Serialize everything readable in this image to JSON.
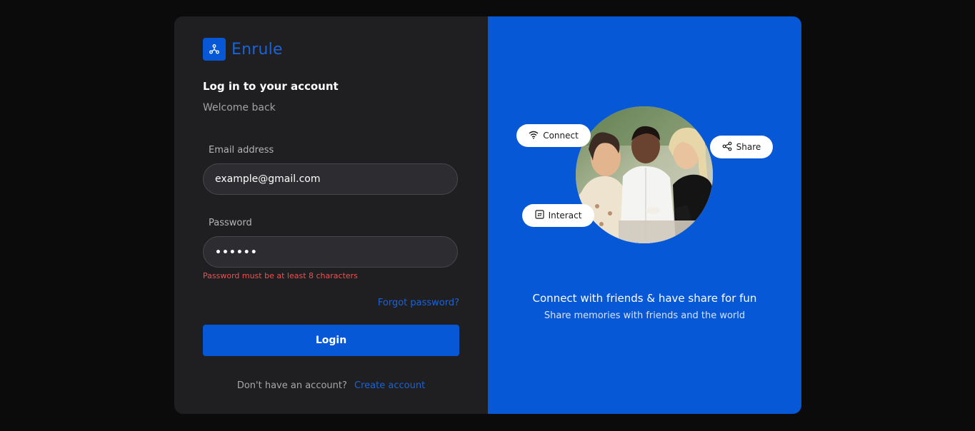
{
  "brand": {
    "name": "Enrule",
    "logo_icon": "network-nodes-icon"
  },
  "login": {
    "title": "Log in to your account",
    "subtitle": "Welcome back",
    "email_label": "Email address",
    "email_value": "example@gmail.com",
    "password_label": "Password",
    "password_value": "••••••",
    "password_error": "Password must be at least 8 characters",
    "forgot_label": "Forgot password?",
    "login_button": "Login",
    "signup_prompt": "Don't have an account?",
    "signup_link": "Create account"
  },
  "promo": {
    "badges": [
      {
        "label": "Connect",
        "icon": "wifi-icon"
      },
      {
        "label": "Share",
        "icon": "share-icon"
      },
      {
        "label": "Interact",
        "icon": "interact-icon"
      }
    ],
    "title": "Connect with friends & have share for fun",
    "subtitle": "Share memories with friends and the world"
  },
  "colors": {
    "page_background": "#0b0b0b",
    "panel_background": "#1f1f21",
    "accent": "#0758d7",
    "link": "#1a63d9",
    "error": "#f05050",
    "input_background": "#2d2c30"
  }
}
